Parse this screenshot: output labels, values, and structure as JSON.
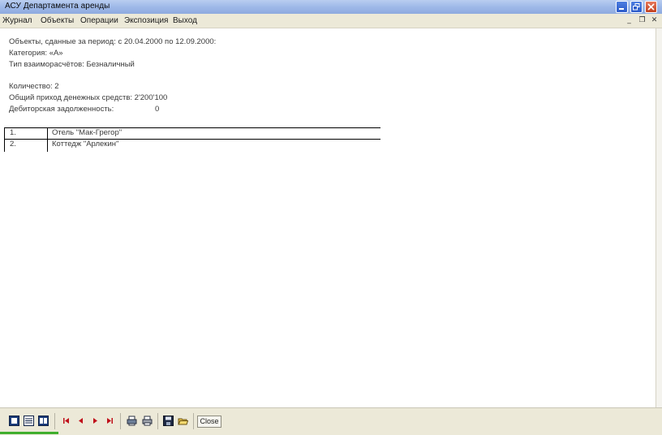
{
  "window": {
    "title": "АСУ Департамента аренды"
  },
  "menu": {
    "items": [
      "Журнал",
      "Объекты",
      "Операции",
      "Экспозиция",
      "Выход"
    ]
  },
  "report": {
    "line1": "Объекты, сданные за период: с 20.04.2000 по 12.09.2000:",
    "line2": "Категория: «А»",
    "line3": "Тип взаиморасчётов: Безналичный",
    "count": "Количество: 2",
    "income": "Общий приход денежных средств: 2'200'100",
    "debt_label": "Дебиторская задолженность:",
    "debt_value": "0"
  },
  "table": {
    "rows": [
      {
        "num": "1.",
        "name": "Отель \"Мак-Грегор\""
      },
      {
        "num": "2.",
        "name": "Коттедж \"Арлекин\""
      }
    ]
  },
  "toolbar": {
    "close_label": "Close",
    "icons": [
      "single-page-icon",
      "multi-page-icon",
      "whole-page-icon",
      "first-page-icon",
      "prev-page-icon",
      "next-page-icon",
      "last-page-icon",
      "print-setup-icon",
      "print-icon",
      "save-icon",
      "open-icon"
    ]
  },
  "colors": {
    "titlebar": "#9fb9e8",
    "close_button": "#c1401e",
    "status_accent": "#3fae2d"
  }
}
